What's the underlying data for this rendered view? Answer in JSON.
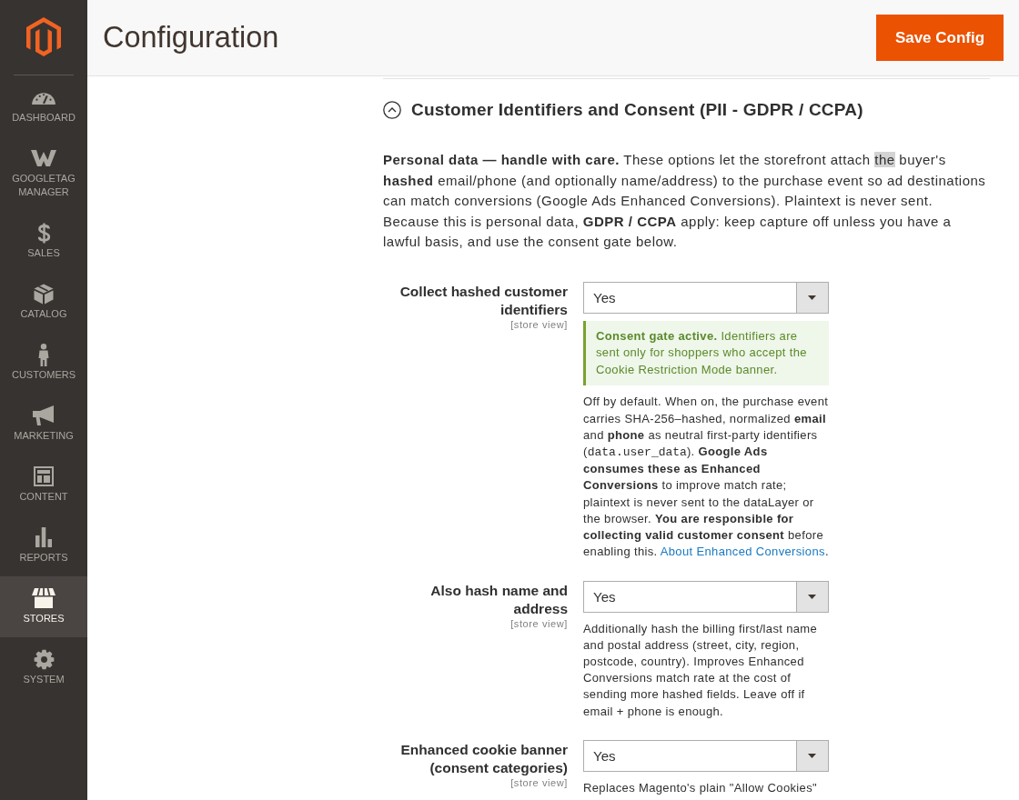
{
  "sidebar": {
    "items": [
      {
        "label": "DASHBOARD",
        "selected": false
      },
      {
        "label": "GOOGLETAG MANAGER",
        "selected": false
      },
      {
        "label": "SALES",
        "selected": false
      },
      {
        "label": "CATALOG",
        "selected": false
      },
      {
        "label": "CUSTOMERS",
        "selected": false
      },
      {
        "label": "MARKETING",
        "selected": false
      },
      {
        "label": "CONTENT",
        "selected": false
      },
      {
        "label": "REPORTS",
        "selected": false
      },
      {
        "label": "STORES",
        "selected": true
      },
      {
        "label": "SYSTEM",
        "selected": false
      }
    ]
  },
  "header": {
    "title": "Configuration",
    "save_button": "Save Config"
  },
  "section": {
    "title": "Customer Identifiers and Consent (PII - GDPR / CCPA)",
    "expanded": true,
    "intro": [
      {
        "kind": "text",
        "text": "**Personal data — handle with care.** These options let the storefront attach "
      },
      {
        "kind": "highlight",
        "text": "the"
      },
      {
        "kind": "text",
        "text": " buyer's **hashed** email/phone (and optionally name/address) to the purchase event so ad destinations can match conversions (Google Ads Enhanced Conversions). Plaintext is never sent. Because this is personal data, **GDPR / CCPA** apply: keep capture off unless you have a lawful basis, and use the consent gate below."
      }
    ],
    "fields": [
      {
        "label": "Collect hashed customer identifiers",
        "scope": "[store view]",
        "value": "Yes",
        "notice": "**Consent gate active.** Identifiers are sent only for shoppers who accept the Cookie Restriction Mode banner.",
        "description": [
          {
            "kind": "text",
            "text": "Off by default. When on, the purchase event carries SHA-256–hashed, normalized **email** and **phone** as neutral first-party identifiers ("
          },
          {
            "kind": "code",
            "text": "data.user_data"
          },
          {
            "kind": "text",
            "text": "). **Google Ads consumes these as Enhanced Conversions** to improve match rate; plaintext is never sent to the dataLayer or the browser. **You are responsible for collecting valid customer consent** before enabling this. "
          },
          {
            "kind": "link",
            "text": "About Enhanced Conversions"
          },
          {
            "kind": "text",
            "text": "."
          }
        ]
      },
      {
        "label": "Also hash name and address",
        "scope": "[store view]",
        "value": "Yes",
        "description": [
          {
            "kind": "text",
            "text": "Additionally hash the billing first/last name and postal address (street, city, region, postcode, country). Improves Enhanced Conversions match rate at the cost of sending more hashed fields. Leave off if email + phone is enough."
          }
        ]
      },
      {
        "label": "Enhanced cookie banner (consent categories)",
        "scope": "[store view]",
        "value": "Yes",
        "description": [
          {
            "kind": "text",
            "text": "Replaces Magento's plain \"Allow Cookies\""
          }
        ]
      }
    ]
  }
}
